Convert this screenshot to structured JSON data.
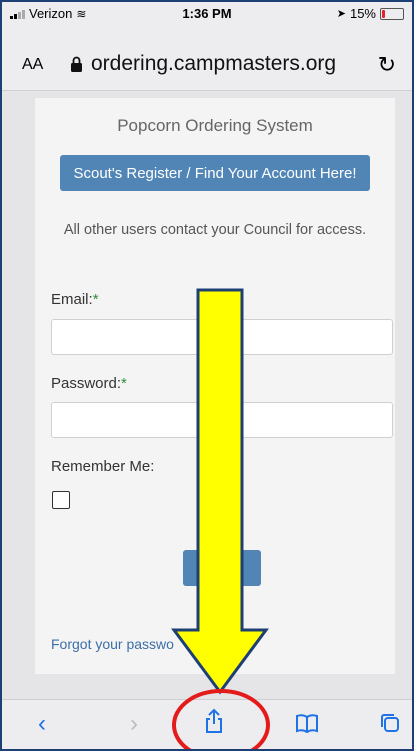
{
  "status": {
    "carrier": "Verizon",
    "time": "1:36 PM",
    "battery": "15%",
    "battery_fraction": 0.15
  },
  "browser": {
    "aa": "AA",
    "url": "ordering.campmasters.org"
  },
  "page": {
    "title": "Popcorn Ordering System",
    "register_button": "Scout's Register / Find Your Account Here!",
    "note": "All other users contact your Council for access.",
    "email_label": "Email:",
    "password_label": "Password:",
    "required_mark": "*",
    "remember_label": "Remember Me:",
    "forgot_link": "Forgot your passwo"
  },
  "toolbar": {
    "back_icon": "back-chevron-icon",
    "forward_icon": "forward-chevron-icon",
    "share_icon": "share-icon",
    "bookmarks_icon": "book-icon",
    "tabs_icon": "tabs-icon"
  },
  "colors": {
    "button": "#5085b5",
    "arrow_fill": "#ffff00",
    "circle": "#e31b1b",
    "accent": "#1f73e6"
  }
}
